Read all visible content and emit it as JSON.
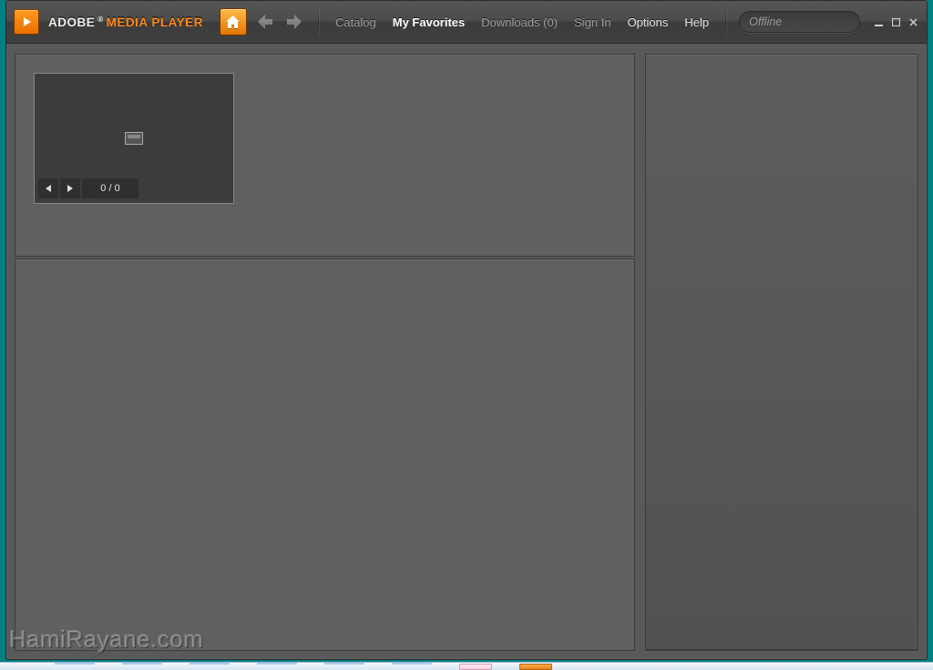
{
  "brand": {
    "adobe": "ADOBE",
    "reg": "®",
    "product": "MEDIA PLAYER"
  },
  "nav": {
    "catalog": "Catalog",
    "my_favorites": "My Favorites",
    "downloads": "Downloads (0)",
    "sign_in": "Sign In",
    "options": "Options",
    "help": "Help"
  },
  "search": {
    "placeholder": "Offline"
  },
  "gallery": {
    "counter": "0 / 0"
  },
  "watermark": "HamiRayane.com"
}
